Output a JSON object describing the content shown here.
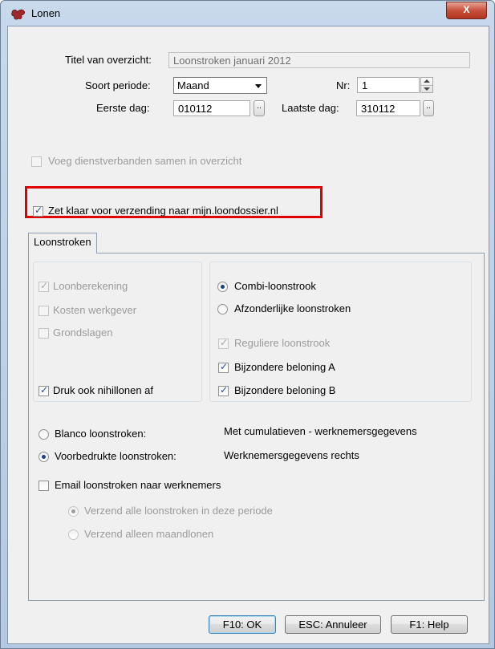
{
  "window": {
    "title": "Lonen",
    "close_label": "X"
  },
  "header": {
    "titel_label": "Titel van overzicht:",
    "titel_value": "Loonstroken januari 2012",
    "soort_periode_label": "Soort periode:",
    "soort_periode_value": "Maand",
    "nr_label": "Nr:",
    "nr_value": "1",
    "eerste_dag_label": "Eerste dag:",
    "eerste_dag_value": "010112",
    "laatste_dag_label": "Laatste dag:",
    "laatste_dag_value": "310112",
    "picker_label": "..",
    "voeg_label": "Voeg dienstverbanden samen in overzicht",
    "zet_klaar_label": "Zet klaar voor verzending naar mijn.loondossier.nl"
  },
  "tabs": [
    {
      "label": "Loonstroken"
    }
  ],
  "left_group": {
    "loonberekening": "Loonberekening",
    "kosten_werkgever": "Kosten werkgever",
    "grondslagen": "Grondslagen",
    "druk_nihillonen": "Druk ook nihillonen af"
  },
  "right_group": {
    "combi": "Combi-loonstrook",
    "afzonderlijke": "Afzonderlijke loonstroken",
    "reguliere": "Reguliere loonstrook",
    "bijzondere_a": "Bijzondere beloning A",
    "bijzondere_b": "Bijzondere beloning B"
  },
  "print_options": {
    "blanco_label": "Blanco loonstroken:",
    "blanco_value": "Met cumulatieven - werknemersgegevens",
    "voorbedrukte_label": "Voorbedrukte loonstroken:",
    "voorbedrukte_value": "Werknemersgegevens rechts"
  },
  "email": {
    "label": "Email loonstroken naar werknemers",
    "option_all": "Verzend alle loonstroken in deze periode",
    "option_monthly": "Verzend alleen maandlonen"
  },
  "buttons": {
    "ok": "F10: OK",
    "cancel": "ESC: Annuleer",
    "help": "F1: Help"
  },
  "colors": {
    "highlight": "#e00000",
    "title_bar": "#b9cde5",
    "close_button": "#c8513c"
  }
}
